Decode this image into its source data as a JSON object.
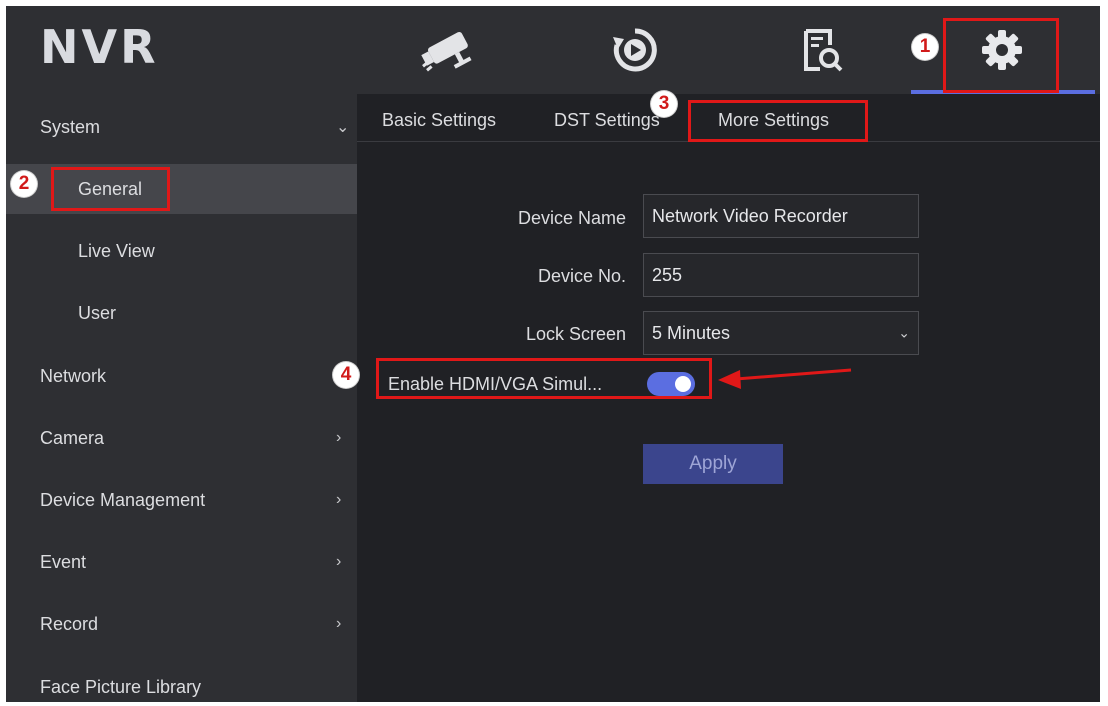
{
  "app": {
    "logo": "NVR"
  },
  "nav": {
    "icons": [
      "camera-icon",
      "playback-icon",
      "search-file-icon",
      "gear-icon"
    ],
    "active": "gear-icon",
    "accent": "#5b6ee1"
  },
  "sidebar": {
    "items": [
      {
        "label": "System",
        "chevron": "⌄"
      },
      {
        "label": "General"
      },
      {
        "label": "Live View"
      },
      {
        "label": "User"
      },
      {
        "label": "Network"
      },
      {
        "label": "Camera",
        "chevron": "›"
      },
      {
        "label": "Device Management",
        "chevron": "›"
      },
      {
        "label": "Event",
        "chevron": "›"
      },
      {
        "label": "Record",
        "chevron": "›"
      },
      {
        "label": "Face Picture Library"
      }
    ]
  },
  "tabs": [
    {
      "label": "Basic Settings"
    },
    {
      "label": "DST Settings"
    },
    {
      "label": "More Settings"
    }
  ],
  "form": {
    "device_name": {
      "label": "Device Name",
      "value": "Network Video Recorder"
    },
    "device_no": {
      "label": "Device No.",
      "value": "255"
    },
    "lock_screen": {
      "label": "Lock Screen",
      "value": "5 Minutes"
    },
    "hdmi_vga": {
      "label": "Enable HDMI/VGA Simul...",
      "enabled": true
    },
    "apply_label": "Apply"
  },
  "annotations": {
    "badges": [
      "1",
      "2",
      "3",
      "4"
    ],
    "color": "#e01818"
  }
}
